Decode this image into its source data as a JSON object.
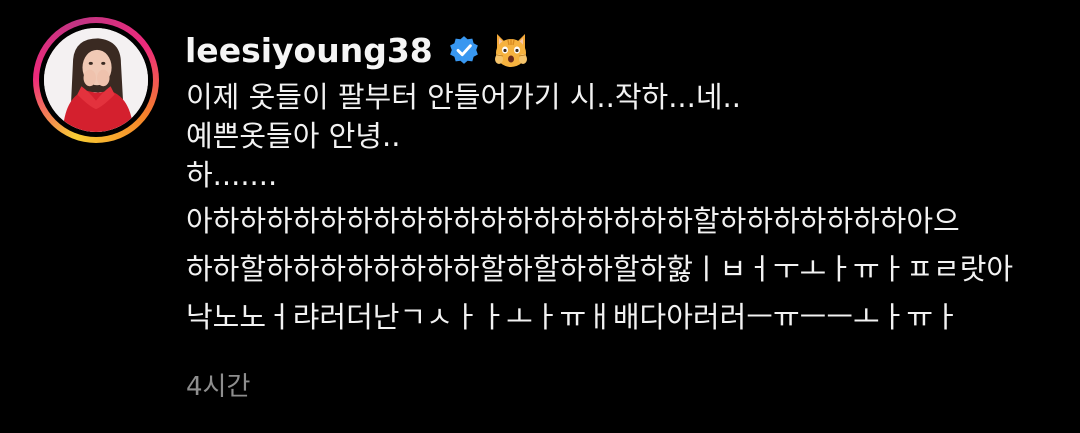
{
  "post": {
    "username": "leesiyoung38",
    "verified_icon": "verified-badge-icon",
    "emoji_icon": "weary-cat-face-emoji",
    "caption_lines": [
      "이제 옷들이 팔부터 안들어가기 시..작하...네..",
      "예쁜옷들아 안녕..",
      "하.......",
      "아하하하하하하하하하하하하하하하하하하할하하하하하하하아으",
      "하하할하하하하하하하하할하할하하할하핧ㅣㅂㅓㅜㅗㅏㅠㅏㅍㄹ랏아",
      "낙노노ㅓ랴러더난ㄱㅅㅏㅏㅗㅏㅠㅐ배다아러러ㅡㅠㅡㅡㅗㅏㅠㅏ"
    ],
    "timestamp": "4시간"
  },
  "colors": {
    "background": "#000000",
    "text": "#f2f2f2",
    "muted": "#8e8e8e",
    "verified_blue": "#3897f0"
  }
}
